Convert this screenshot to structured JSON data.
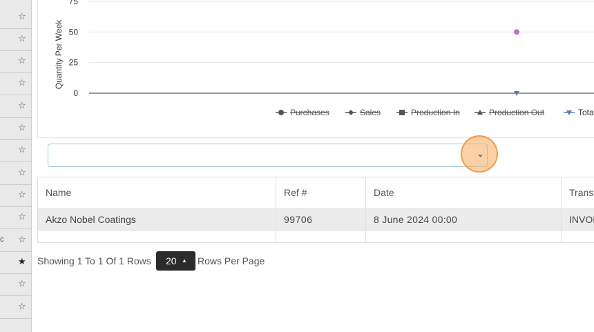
{
  "sidebar": {
    "rows": [
      {
        "icon": "star-outline-icon",
        "glyph": "☆"
      },
      {
        "icon": "star-outline-icon",
        "glyph": "☆"
      },
      {
        "icon": "star-outline-icon",
        "glyph": "☆"
      },
      {
        "icon": "star-outline-icon",
        "glyph": "☆"
      },
      {
        "icon": "star-outline-icon",
        "glyph": "☆"
      },
      {
        "icon": "star-outline-icon",
        "glyph": "☆"
      },
      {
        "icon": "star-outline-icon",
        "glyph": "☆"
      },
      {
        "icon": "star-outline-icon",
        "glyph": "☆"
      },
      {
        "icon": "star-outline-icon",
        "glyph": "☆"
      },
      {
        "icon": "star-outline-icon",
        "glyph": "☆"
      },
      {
        "icon": "star-outline-icon",
        "glyph": "☆",
        "fragment": "c"
      },
      {
        "icon": "star-filled-icon",
        "glyph": "★"
      },
      {
        "icon": "star-outline-icon",
        "glyph": "☆"
      },
      {
        "icon": "star-outline-icon",
        "glyph": "☆"
      }
    ]
  },
  "chart_data": {
    "type": "line",
    "ylabel": "Quantity Per Week",
    "y_ticks": [
      "0",
      "25",
      "50",
      "75"
    ],
    "ylim": [
      0,
      75
    ],
    "grid": true,
    "legend_position": "bottom",
    "series": [
      {
        "name": "Purchases",
        "color": "#555555",
        "marker": "circle",
        "hidden": true,
        "points": []
      },
      {
        "name": "Sales",
        "color": "#555555",
        "marker": "diamond",
        "hidden": true,
        "points": []
      },
      {
        "name": "Production In",
        "color": "#555555",
        "marker": "square",
        "hidden": true,
        "points": []
      },
      {
        "name": "Production Out",
        "color": "#555555",
        "marker": "triangle",
        "hidden": true,
        "points": []
      },
      {
        "name": "Tota",
        "color": "#5b7fb5",
        "marker": "triangle-down",
        "hidden": false,
        "points": [
          {
            "y": 0
          }
        ]
      },
      {
        "name": "",
        "color": "#c66ad6",
        "marker": "circle",
        "hidden": false,
        "points": [
          {
            "y": 50
          }
        ]
      }
    ]
  },
  "select": {
    "value": "",
    "chevron": "⌄"
  },
  "table": {
    "headers": [
      "Name",
      "Ref #",
      "Date",
      "Transa"
    ],
    "rows": [
      [
        "Akzo Nobel Coatings",
        "99706",
        "8 June 2024 00:00",
        "INVOIC"
      ]
    ]
  },
  "pagination": {
    "showing_text": "Showing 1 To 1 Of 1 Rows",
    "rows_per_page_value": "20",
    "rows_per_page_label": "Rows Per Page",
    "caret": "▲"
  }
}
